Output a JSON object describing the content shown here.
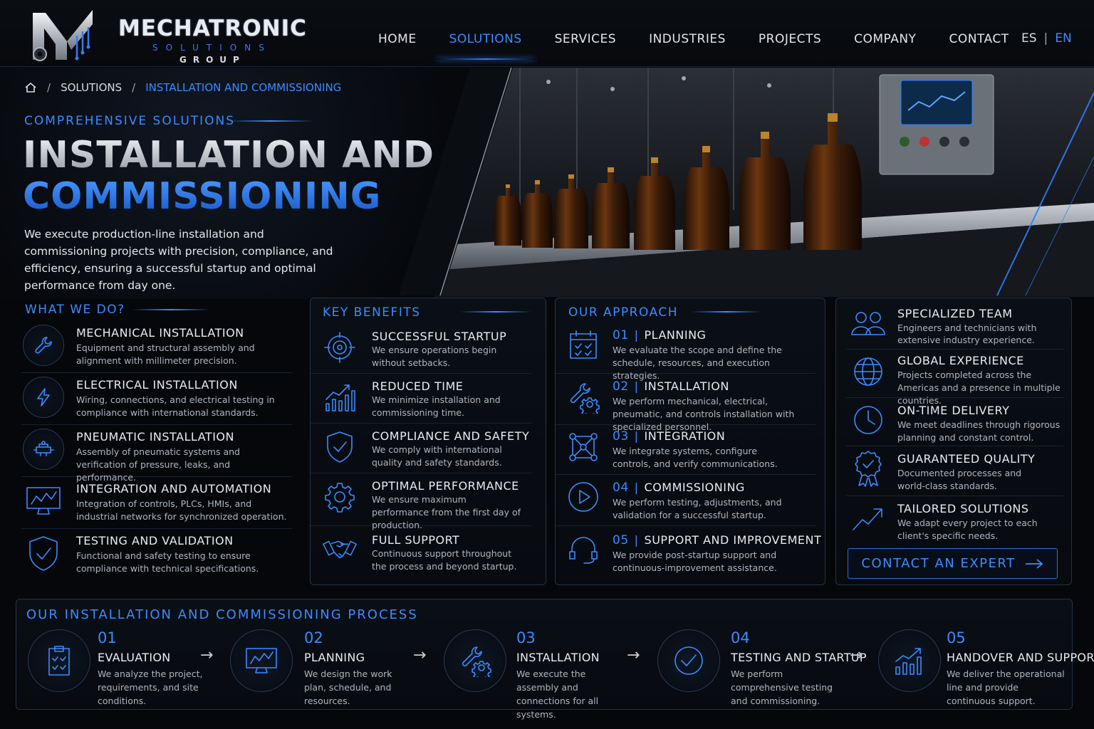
{
  "brand": {
    "name": "MECHATRONIC",
    "sub": "SOLUTIONS",
    "group": "GROUP"
  },
  "nav": [
    {
      "label": "HOME",
      "active": false
    },
    {
      "label": "SOLUTIONS",
      "active": true
    },
    {
      "label": "SERVICES",
      "active": false
    },
    {
      "label": "INDUSTRIES",
      "active": false
    },
    {
      "label": "PROJECTS",
      "active": false
    },
    {
      "label": "COMPANY",
      "active": false
    },
    {
      "label": "CONTACT",
      "active": false
    }
  ],
  "lang": {
    "es": "ES",
    "sep": "|",
    "en": "EN",
    "active": "EN"
  },
  "breadcrumb": {
    "home_icon": "home-icon",
    "level1": "SOLUTIONS",
    "current": "INSTALLATION AND COMMISSIONING"
  },
  "hero": {
    "eyebrow": "COMPREHENSIVE SOLUTIONS",
    "title_line1": "INSTALLATION AND",
    "title_line2": "COMMISSIONING",
    "intro": "We execute production-line installation and commissioning projects with precision, compliance, and efficiency, ensuring a successful startup and optimal performance from day one."
  },
  "what_we_do": {
    "title": "WHAT WE DO?",
    "items": [
      {
        "icon": "wrench-icon",
        "title": "MECHANICAL INSTALLATION",
        "desc": "Equipment and structural assembly and alignment with millimeter precision."
      },
      {
        "icon": "lightning-icon",
        "title": "ELECTRICAL INSTALLATION",
        "desc": "Wiring, connections, and electrical testing in compliance with international standards."
      },
      {
        "icon": "pneumatic-icon",
        "title": "PNEUMATIC INSTALLATION",
        "desc": "Assembly of pneumatic systems and verification of pressure, leaks, and performance."
      },
      {
        "icon": "monitor-chart-icon",
        "title": "INTEGRATION AND AUTOMATION",
        "desc": "Integration of controls, PLCs, HMIs, and industrial networks for synchronized operation."
      },
      {
        "icon": "shield-check-icon",
        "title": "TESTING AND VALIDATION",
        "desc": "Functional and safety testing to ensure compliance with technical specifications."
      }
    ]
  },
  "key_benefits": {
    "title": "KEY BENEFITS",
    "items": [
      {
        "icon": "target-icon",
        "title": "SUCCESSFUL STARTUP",
        "desc": "We ensure operations begin without setbacks."
      },
      {
        "icon": "growth-chart-icon",
        "title": "REDUCED TIME",
        "desc": "We minimize installation and commissioning time."
      },
      {
        "icon": "shield-check-icon",
        "title": "COMPLIANCE AND SAFETY",
        "desc": "We comply with international quality and safety standards."
      },
      {
        "icon": "gear-icon",
        "title": "OPTIMAL PERFORMANCE",
        "desc": "We ensure maximum performance from the first day of production."
      },
      {
        "icon": "handshake-icon",
        "title": "FULL SUPPORT",
        "desc": "Continuous support throughout the process and beyond startup."
      }
    ]
  },
  "approach": {
    "title": "OUR APPROACH",
    "items": [
      {
        "icon": "calendar-icon",
        "num": "01",
        "title": "PLANNING",
        "desc": "We evaluate the scope and define the schedule, resources, and execution strategies."
      },
      {
        "icon": "tools-gear-icon",
        "num": "02",
        "title": "INSTALLATION",
        "desc": "We perform mechanical, electrical, pneumatic, and controls installation with specialized personnel."
      },
      {
        "icon": "network-icon",
        "num": "03",
        "title": "INTEGRATION",
        "desc": "We integrate systems, configure controls, and verify communications."
      },
      {
        "icon": "play-icon",
        "num": "04",
        "title": "COMMISSIONING",
        "desc": "We perform testing, adjustments, and validation for a successful startup."
      },
      {
        "icon": "headset-icon",
        "num": "05",
        "title": "SUPPORT AND IMPROVEMENT",
        "desc": "We provide post-startup support and continuous-improvement assistance."
      }
    ]
  },
  "strengths": {
    "items": [
      {
        "icon": "team-icon",
        "title": "SPECIALIZED TEAM",
        "desc": "Engineers and technicians with extensive industry experience."
      },
      {
        "icon": "globe-icon",
        "title": "GLOBAL EXPERIENCE",
        "desc": "Projects completed across the Americas and a presence in multiple countries."
      },
      {
        "icon": "clock-icon",
        "title": "ON-TIME DELIVERY",
        "desc": "We meet deadlines through rigorous planning and constant control."
      },
      {
        "icon": "award-icon",
        "title": "GUARANTEED QUALITY",
        "desc": "Documented processes and world-class standards."
      },
      {
        "icon": "trend-arrow-icon",
        "title": "TAILORED SOLUTIONS",
        "desc": "We adapt every project to each client's specific needs."
      }
    ],
    "cta": "CONTACT AN EXPERT"
  },
  "process": {
    "title": "OUR INSTALLATION AND COMMISSIONING PROCESS",
    "steps": [
      {
        "icon": "clipboard-check-icon",
        "num": "01",
        "title": "EVALUATION",
        "desc": "We analyze the project, requirements, and site conditions."
      },
      {
        "icon": "monitor-chart-icon",
        "num": "02",
        "title": "PLANNING",
        "desc": "We design the work plan, schedule, and resources."
      },
      {
        "icon": "tools-gear-icon",
        "num": "03",
        "title": "INSTALLATION",
        "desc": "We execute the assembly and connections for all systems."
      },
      {
        "icon": "check-circle-icon",
        "num": "04",
        "title": "TESTING AND STARTUP",
        "desc": "We perform comprehensive testing and commissioning."
      },
      {
        "icon": "bar-growth-icon",
        "num": "05",
        "title": "HANDOVER AND SUPPORT",
        "desc": "We deliver the operational line and provide continuous support."
      }
    ]
  },
  "colors": {
    "accent": "#3c8bff",
    "background": "#05070b",
    "panel_border": "#263245"
  }
}
